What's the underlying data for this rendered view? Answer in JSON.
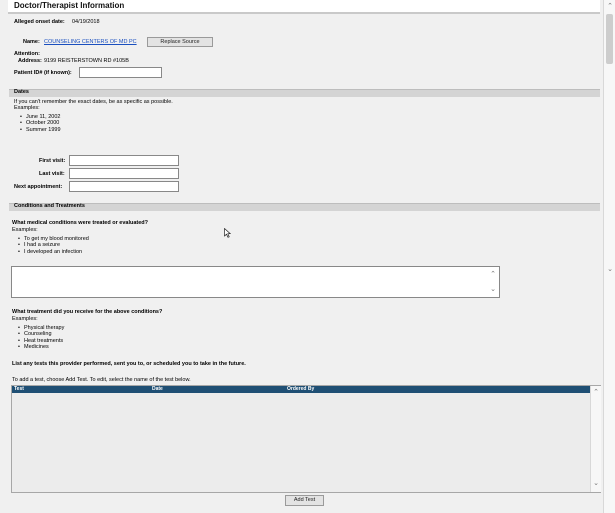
{
  "header": {
    "title": "Doctor/Therapist Information"
  },
  "onset": {
    "label": "Alleged onset date:",
    "value": "04/19/2018"
  },
  "provider": {
    "name_label": "Name:",
    "name_value": "COUNSELING CENTERS OF MD PC",
    "replace_label": "Replace Source",
    "attention_label": "Attention:",
    "address_label": "Address:",
    "address_value": "9199 REISTERSTOWN RD #105B",
    "patient_id_label": "Patient ID# (if known):",
    "patient_id_value": ""
  },
  "dates": {
    "section_title": "Dates",
    "instruction": "If you can't remember the exact dates, be as specific as possible.",
    "examples_label": "Examples:",
    "examples": [
      "June 11, 2002",
      "October 2000",
      "Summer 1999"
    ],
    "first_visit_label": "First visit:",
    "last_visit_label": "Last visit:",
    "next_appt_label": "Next appointment:",
    "first_visit_value": "",
    "last_visit_value": "",
    "next_appt_value": ""
  },
  "conditions": {
    "section_title": "Conditions and Treatments",
    "q1": "What medical conditions were treated or evaluated?",
    "q1_examples_label": "Examples:",
    "q1_examples": [
      "To get my blood monitored",
      "I had a seizure",
      "I developed an infection"
    ],
    "q1_value": "",
    "q2": "What treatment did you receive for the above conditions?",
    "q2_examples_label": "Examples:",
    "q2_examples": [
      "Physical therapy",
      "Counseling",
      "Heat treatments",
      "Medicines"
    ]
  },
  "tests": {
    "heading": "List any tests this provider performed, sent you to, or scheduled you to take in the future.",
    "instruction": "To add a test, choose Add Test. To edit, select the name of the test below.",
    "columns": [
      "Test",
      "Date",
      "Ordered By"
    ],
    "add_label": "Add Test"
  },
  "scroll_glyphs": {
    "up": "⌃",
    "down": "⌄"
  }
}
